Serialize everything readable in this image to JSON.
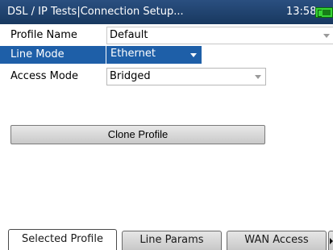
{
  "titlebar": {
    "title": "DSL / IP Tests|Connection Setup...",
    "time": "13:58"
  },
  "form": {
    "profile_name": {
      "label": "Profile Name",
      "value": "Default"
    },
    "line_mode": {
      "label": "Line Mode",
      "value": "Ethernet"
    },
    "access_mode": {
      "label": "Access Mode",
      "value": "Bridged"
    }
  },
  "buttons": {
    "clone_profile": "Clone Profile"
  },
  "tabs": [
    {
      "label": "Selected Profile",
      "active": true
    },
    {
      "label": "Line Params",
      "active": false
    },
    {
      "label": "WAN Access",
      "active": false
    }
  ],
  "colors": {
    "titlebar": "#1f4370",
    "selection": "#1e5fa8",
    "battery": "#37d436"
  },
  "icons": {
    "battery": "battery-charging-icon",
    "dropdown": "chevron-down-icon",
    "tab_scroll": "chevron-right-icon"
  }
}
